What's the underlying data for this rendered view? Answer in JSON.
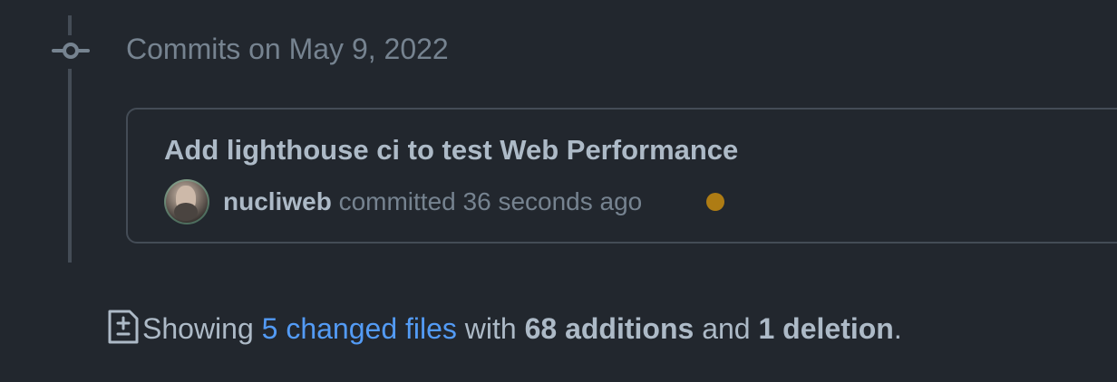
{
  "timeline": {
    "heading": "Commits on May 9, 2022"
  },
  "commit": {
    "title": "Add lighthouse ci to test Web Performance",
    "author": "nucliweb",
    "action": "committed",
    "time": "36 seconds ago",
    "status_color": "#ae7c14"
  },
  "summary": {
    "prefix": "Showing",
    "changed_files": "5 changed files",
    "with": "with",
    "additions": "68 additions",
    "and": "and",
    "deletions": "1 deletion",
    "period": "."
  },
  "icons": {
    "commit": "git-commit-icon",
    "diff": "file-diff-icon"
  }
}
